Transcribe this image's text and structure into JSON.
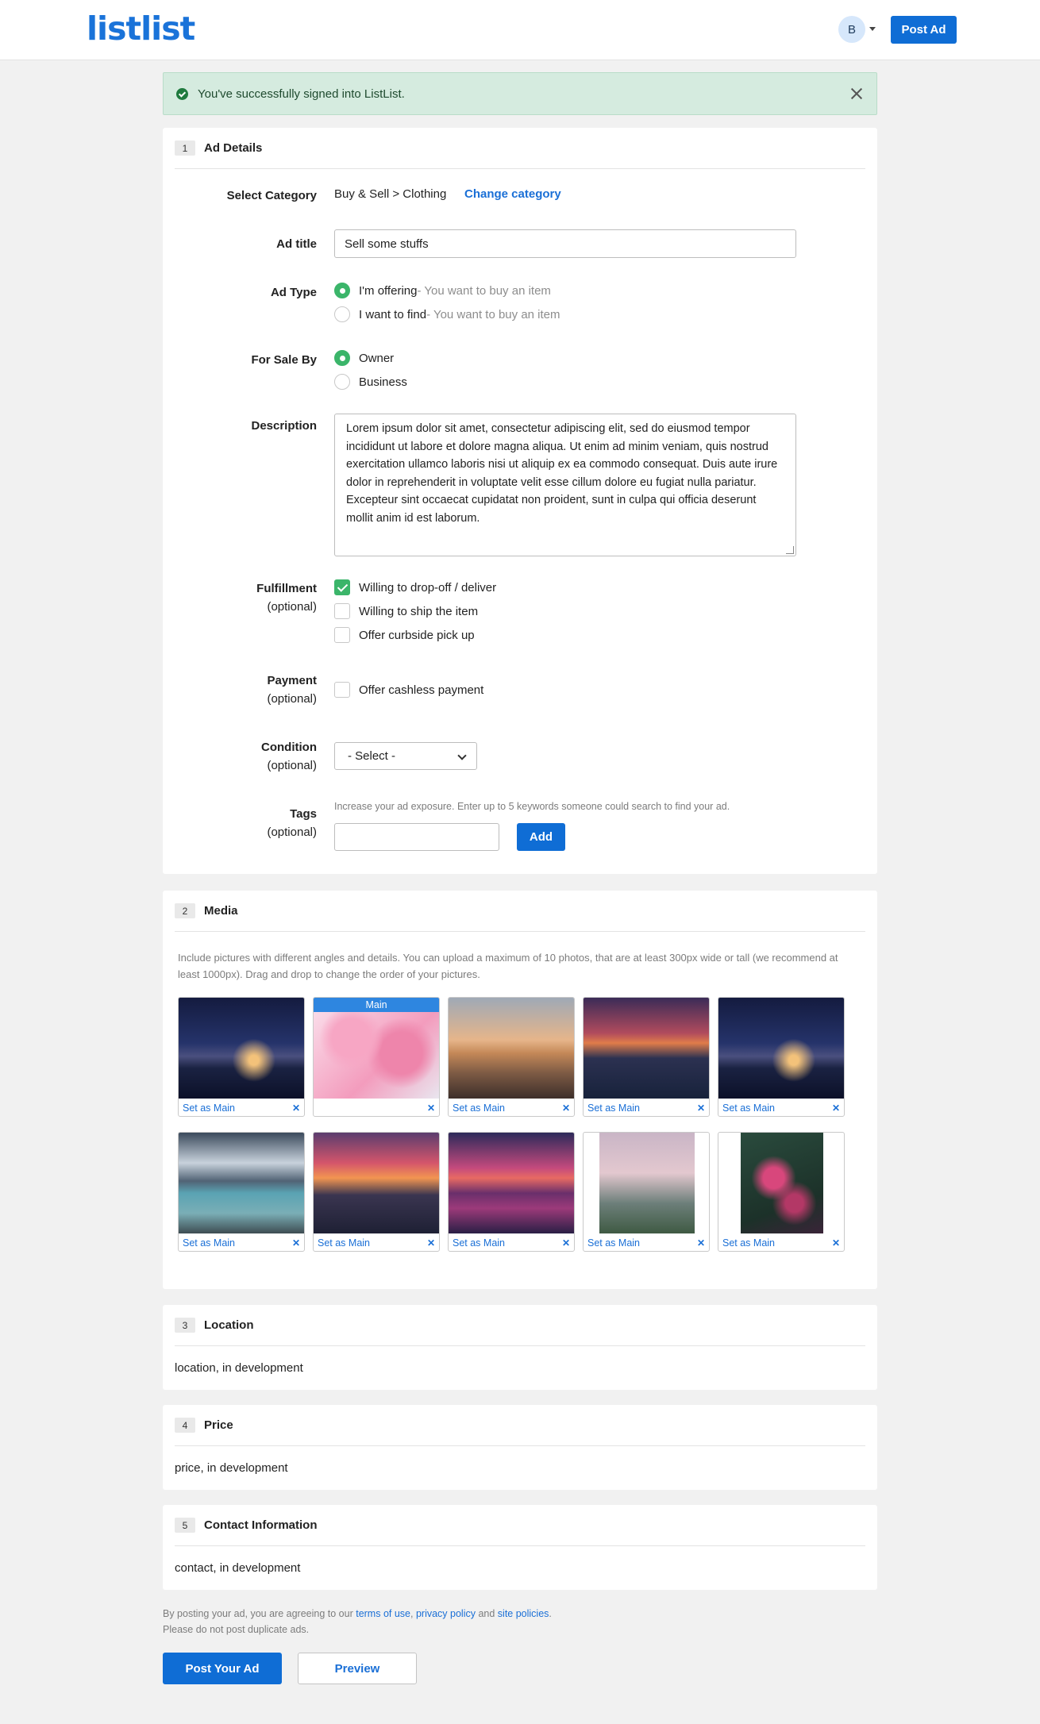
{
  "header": {
    "logo": "listlist",
    "avatar_initial": "B",
    "post_ad_label": "Post Ad"
  },
  "alert": {
    "text": "You've successfully signed into ListList."
  },
  "ad_details": {
    "step": "1",
    "title": "Ad Details",
    "category_label": "Select Category",
    "category_path": "Buy & Sell > Clothing",
    "change_category": "Change category",
    "ad_title_label": "Ad title",
    "ad_title_value": "Sell some stuffs",
    "ad_type_label": "Ad Type",
    "ad_type_options": [
      {
        "label": "I'm offering",
        "hint": "- You want to buy an item",
        "selected": true
      },
      {
        "label": "I want to find",
        "hint": "- You want to buy an item",
        "selected": false
      }
    ],
    "sale_by_label": "For Sale By",
    "sale_by_options": [
      {
        "label": "Owner",
        "selected": true
      },
      {
        "label": "Business",
        "selected": false
      }
    ],
    "description_label": "Description",
    "description_value": "Lorem ipsum dolor sit amet, consectetur adipiscing elit, sed do eiusmod tempor incididunt ut labore et dolore magna aliqua. Ut enim ad minim veniam, quis nostrud exercitation ullamco laboris nisi ut aliquip ex ea commodo consequat. Duis aute irure dolor in reprehenderit in voluptate velit esse cillum dolore eu fugiat nulla pariatur. Excepteur sint occaecat cupidatat non proident, sunt in culpa qui officia deserunt mollit anim id est laborum.",
    "fulfillment_label": "Fulfillment",
    "optional": "(optional)",
    "fulfillment_options": [
      {
        "label": "Willing to drop-off / deliver",
        "checked": true
      },
      {
        "label": "Willing to ship the item",
        "checked": false
      },
      {
        "label": "Offer curbside pick up",
        "checked": false
      }
    ],
    "payment_label": "Payment",
    "payment_option": {
      "label": "Offer cashless payment",
      "checked": false
    },
    "condition_label": "Condition",
    "condition_value": "- Select -",
    "tags_label": "Tags",
    "tags_help": "Increase your ad exposure. Enter up to 5 keywords someone could search to find your ad.",
    "tags_value": "",
    "add_label": "Add"
  },
  "media": {
    "step": "2",
    "title": "Media",
    "help": "Include pictures with different angles and details. You can upload a maximum of 10 photos, that are at least 300px wide or tall (we recommend at least 1000px). Drag and drop to change the order of your pictures.",
    "main_badge": "Main",
    "set_main_label": "Set as Main",
    "remove_label": "✕",
    "photos": [
      {
        "name": "night-tree-lake",
        "main": false
      },
      {
        "name": "cherry-blossom",
        "main": true
      },
      {
        "name": "beach-sunset-palm",
        "main": false
      },
      {
        "name": "mountain-village-dusk",
        "main": false
      },
      {
        "name": "night-tree-lake",
        "main": false
      },
      {
        "name": "mountain-lake",
        "main": false
      },
      {
        "name": "mountain-sunset-village",
        "main": false
      },
      {
        "name": "pier-sunset",
        "main": false
      },
      {
        "name": "eiffel-tower",
        "main": false
      },
      {
        "name": "pink-blossom-branch",
        "main": false
      }
    ]
  },
  "location": {
    "step": "3",
    "title": "Location",
    "text": "location, in development"
  },
  "price": {
    "step": "4",
    "title": "Price",
    "text": "price, in development"
  },
  "contact": {
    "step": "5",
    "title": "Contact Information",
    "text": "contact, in development"
  },
  "footer": {
    "legal_prefix": "By posting your ad, you are agreeing to our ",
    "terms": "terms of use",
    "comma": ", ",
    "privacy": "privacy policy",
    "and": " and ",
    "site_policies": "site policies",
    "period": ".",
    "duplicate_note": "Please do not post duplicate ads.",
    "post_label": "Post Your Ad",
    "preview_label": "Preview"
  },
  "colors": {
    "brand": "#1a73d9",
    "primary_button": "#0f6dd5",
    "success_bg": "#d5ebdf",
    "check_green": "#3bb56a",
    "main_badge": "#2e86e0"
  }
}
